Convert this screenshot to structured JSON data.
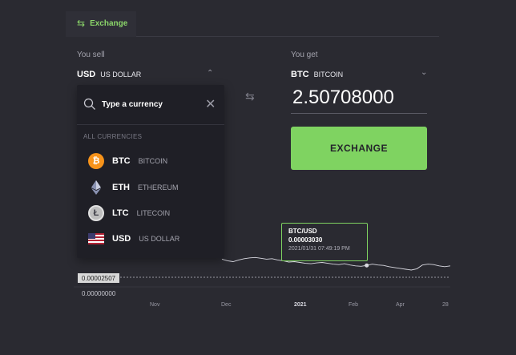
{
  "tab": {
    "label": "Exchange",
    "icon": "exchange-arrows-icon"
  },
  "sell": {
    "label": "You sell",
    "code": "USD",
    "name": "US DOLLAR"
  },
  "get": {
    "label": "You get",
    "code": "BTC",
    "name": "BITCOIN",
    "amount": "2.50708000"
  },
  "exchange_button": "EXCHANGE",
  "dropdown": {
    "search_placeholder": "Type a currency",
    "section_label": "ALL CURRENCIES",
    "items": [
      {
        "code": "BTC",
        "name": "BITCOIN",
        "icon": "bitcoin-icon",
        "color": "#f7931a"
      },
      {
        "code": "ETH",
        "name": "ETHEREUM",
        "icon": "ethereum-icon",
        "color": "#8a92b2"
      },
      {
        "code": "LTC",
        "name": "LITECOIN",
        "icon": "litecoin-icon",
        "color": "#bebebe"
      },
      {
        "code": "USD",
        "name": "US DOLLAR",
        "icon": "us-flag-icon",
        "color": "#b22234"
      }
    ]
  },
  "chart_data": {
    "type": "line",
    "pair_label": "BTC/USD",
    "tooltip_value": "0.00003030",
    "tooltip_time": "2021/01/31 07:49:19 PM",
    "current_price_label": "0.00002507",
    "baseline_label": "0.00000000",
    "x_ticks": [
      "Nov",
      "Dec",
      "2021",
      "Feb",
      "Apr",
      "28"
    ],
    "series": [
      {
        "values": [
          3.3,
          3.1,
          3.0,
          3.2,
          3.35,
          3.45,
          3.5,
          3.4,
          3.3,
          3.35,
          3.2,
          3.1,
          2.95,
          3.0,
          2.9,
          2.8,
          2.75,
          2.85,
          2.9,
          2.8,
          2.7,
          2.65,
          2.75,
          2.6,
          2.5,
          2.45,
          2.55,
          2.7,
          2.6,
          2.55,
          2.4,
          2.3,
          2.2,
          2.1,
          2.0,
          2.15,
          2.6,
          2.7,
          2.65,
          2.5,
          2.4,
          2.5
        ]
      }
    ],
    "colors": {
      "line": "#d8d8e0",
      "accent": "#7fd361"
    }
  }
}
